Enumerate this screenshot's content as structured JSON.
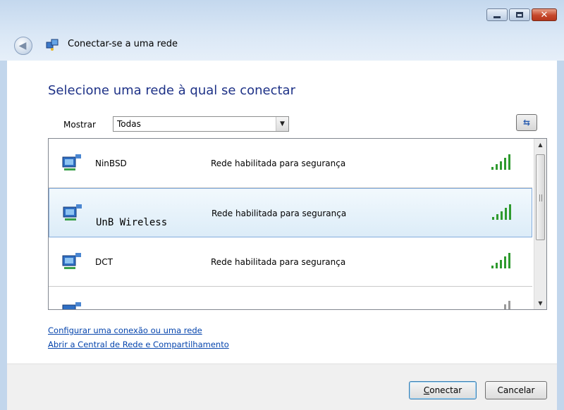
{
  "window": {
    "title": "Conectar-se a uma rede",
    "caption_buttons": [
      "minimize",
      "maximize",
      "close"
    ]
  },
  "main": {
    "heading": "Selecione uma rede à qual se conectar",
    "show": {
      "label": "Mostrar",
      "selected": "Todas"
    }
  },
  "networks": [
    {
      "name": "NinBSD",
      "security": "Rede habilitada para segurança",
      "signal_bars": 5,
      "selected": false
    },
    {
      "name": "UnB Wireless",
      "security": "Rede habilitada para segurança",
      "signal_bars": 5,
      "selected": true
    },
    {
      "name": "DCT",
      "security": "Rede habilitada para segurança",
      "signal_bars": 5,
      "selected": false
    }
  ],
  "links": {
    "setup": "Configurar uma conexão ou uma rede",
    "center": "Abrir a Central de Rede e Compartilhamento"
  },
  "buttons": {
    "connect_access_key": "C",
    "connect_rest": "onectar",
    "cancel": "Cancelar"
  },
  "colors": {
    "heading": "#1e3287",
    "link": "#0645ad",
    "signal": "#2e9a2e",
    "selection": "#dcecf8"
  }
}
